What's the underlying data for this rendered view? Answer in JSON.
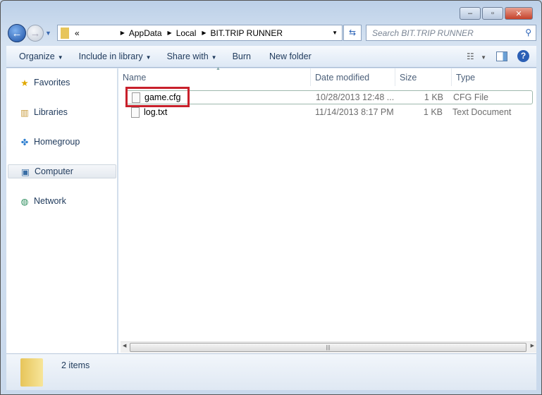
{
  "window": {
    "minimize": "▭",
    "maximize": "▢",
    "close": "✕"
  },
  "address": {
    "overflow": "«",
    "crumbs": [
      "AppData",
      "Local",
      "BIT.TRIP RUNNER"
    ],
    "search_placeholder": "Search BIT.TRIP RUNNER"
  },
  "toolbar": {
    "organize": "Organize",
    "include": "Include in library",
    "share": "Share with",
    "burn": "Burn",
    "new_folder": "New folder",
    "help": "?"
  },
  "nav": {
    "items": [
      "Favorites",
      "Libraries",
      "Homegroup",
      "Computer",
      "Network"
    ],
    "selected": "Computer"
  },
  "columns": [
    "Name",
    "Date modified",
    "Size",
    "Type"
  ],
  "files": [
    {
      "name": "game.cfg",
      "date": "10/28/2013 12:48 ...",
      "size": "1 KB",
      "type": "CFG File"
    },
    {
      "name": "log.txt",
      "date": "11/14/2013 8:17 PM",
      "size": "1 KB",
      "type": "Text Document"
    }
  ],
  "status": {
    "count": "2 items"
  },
  "colors": {
    "highlight": "#c8202b"
  }
}
